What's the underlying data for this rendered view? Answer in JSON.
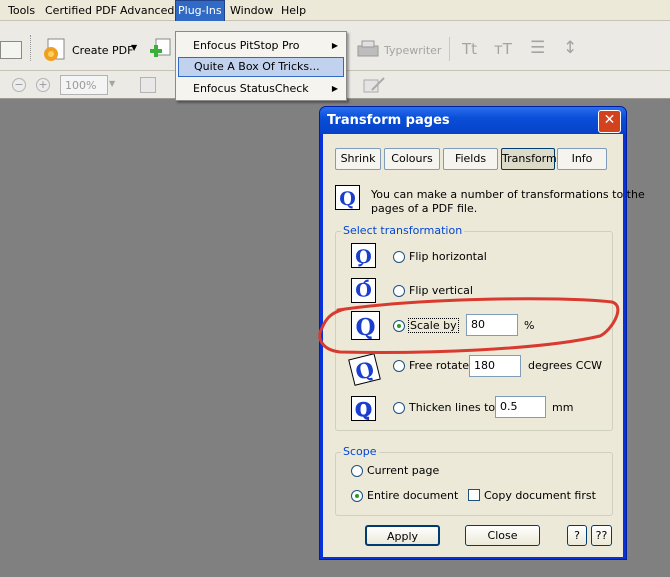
{
  "menubar": {
    "items": [
      "Tools",
      "Certified PDF",
      "Advanced",
      "Plug-Ins",
      "Window",
      "Help"
    ],
    "active": "Plug-Ins"
  },
  "toolbar": {
    "create_pdf_label": "Create PDF",
    "typewriter_label": "Typewriter",
    "zoom_value": "100%"
  },
  "plugins_menu": {
    "items": [
      {
        "label": "Enfocus PitStop Pro",
        "submenu": true,
        "selected": false
      },
      {
        "label": "Quite A Box Of Tricks...",
        "submenu": false,
        "selected": true
      },
      {
        "label": "Enfocus StatusCheck",
        "submenu": true,
        "selected": false
      }
    ]
  },
  "dialog": {
    "title": "Transform pages",
    "tabs": [
      "Shrink",
      "Colours",
      "Fields",
      "Transform",
      "Info"
    ],
    "active_tab": "Transform",
    "description": [
      "You can make a number of transformations to the",
      "pages of a PDF file."
    ],
    "group_transform_label": "Select transformation",
    "options": {
      "flip_h": "Flip horizontal",
      "flip_v": "Flip vertical",
      "scale": "Scale by",
      "scale_value": "80",
      "scale_unit": "%",
      "rotate": "Free rotate",
      "rotate_value": "180",
      "rotate_unit": "degrees CCW",
      "thicken": "Thicken lines to",
      "thicken_value": "0.5",
      "thicken_unit": "mm"
    },
    "selected_option": "scale",
    "scope_label": "Scope",
    "scope": {
      "current": "Current page",
      "entire": "Entire document",
      "copy": "Copy document first",
      "selected": "entire",
      "copy_checked": false
    },
    "buttons": {
      "apply": "Apply",
      "close": "Close",
      "help": "?",
      "help2": "??"
    }
  },
  "colors": {
    "annotation": "#d93a2f",
    "dialog_blue": "#0831d9",
    "menu_active": "#316ac5"
  }
}
